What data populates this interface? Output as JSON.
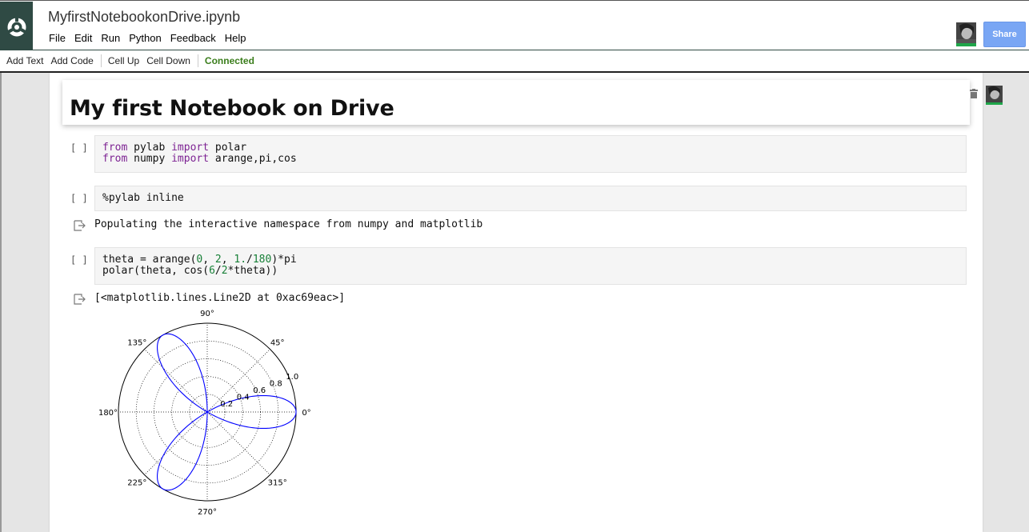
{
  "header": {
    "title": "MyfirstNotebookonDrive.ipynb",
    "menu": [
      "File",
      "Edit",
      "Run",
      "Python",
      "Feedback",
      "Help"
    ],
    "share_label": "Share"
  },
  "toolbar": {
    "add_text": "Add Text",
    "add_code": "Add Code",
    "cell_up": "Cell Up",
    "cell_down": "Cell Down",
    "status": "Connected"
  },
  "text_cell": {
    "heading": "My first Notebook on Drive"
  },
  "cells": [
    {
      "prompt": "[ ]",
      "lines": [
        [
          {
            "t": "from",
            "c": "kw"
          },
          {
            "t": " pylab "
          },
          {
            "t": "import",
            "c": "kw"
          },
          {
            "t": " polar"
          }
        ],
        [
          {
            "t": "from",
            "c": "kw"
          },
          {
            "t": " numpy "
          },
          {
            "t": "import",
            "c": "kw"
          },
          {
            "t": " arange,pi,cos"
          }
        ]
      ]
    },
    {
      "prompt": "[ ]",
      "lines": [
        [
          {
            "t": "%pylab inline"
          }
        ]
      ],
      "output": "Populating the interactive namespace from numpy and matplotlib"
    },
    {
      "prompt": "[ ]",
      "lines": [
        [
          {
            "t": "theta = arange("
          },
          {
            "t": "0",
            "c": "num"
          },
          {
            "t": ", "
          },
          {
            "t": "2",
            "c": "num"
          },
          {
            "t": ", "
          },
          {
            "t": "1.",
            "c": "num"
          },
          {
            "t": "/"
          },
          {
            "t": "180",
            "c": "num"
          },
          {
            "t": ")*pi"
          }
        ],
        [
          {
            "t": "polar(theta, cos("
          },
          {
            "t": "6",
            "c": "num"
          },
          {
            "t": "/"
          },
          {
            "t": "2",
            "c": "num"
          },
          {
            "t": "*theta))"
          }
        ]
      ],
      "output": "[<matplotlib.lines.Line2D at 0xac69eac>]"
    }
  ],
  "chart_data": {
    "type": "line",
    "projection": "polar",
    "function": "r = cos(3*theta), theta from 0 to 2*pi",
    "angle_tick_labels": [
      "0°",
      "45°",
      "90°",
      "135°",
      "180°",
      "225°",
      "270°",
      "315°"
    ],
    "radial_tick_labels": [
      "0.2",
      "0.4",
      "0.6",
      "0.8",
      "1.0"
    ],
    "rlim": [
      0,
      1.0
    ],
    "grid": true,
    "series": [
      {
        "color": "#0000ff"
      }
    ]
  }
}
